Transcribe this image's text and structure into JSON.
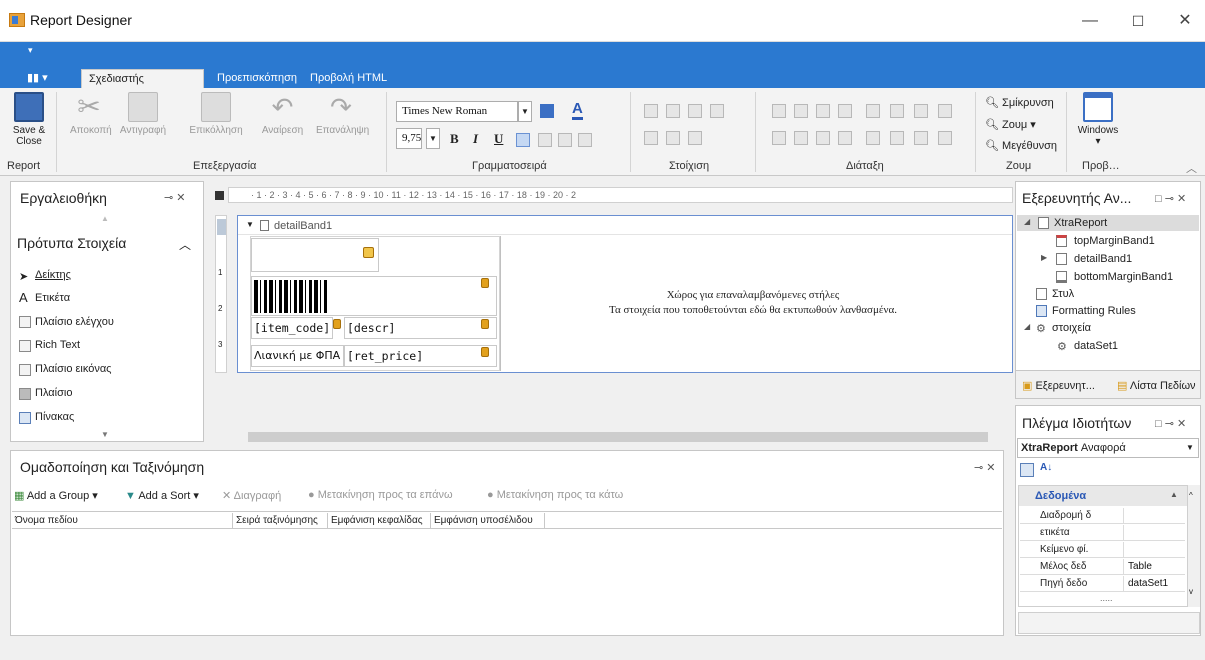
{
  "window": {
    "title": "Report Designer",
    "min": "—",
    "max": "☐",
    "close": "✕"
  },
  "tabs": [
    "Σχεδιαστής Αναφορών",
    "Προεπισκόπηση",
    "Προβολή HTML"
  ],
  "ribbon": {
    "save": "Save &",
    "save2": "Close",
    "cut": "Αποκοπή",
    "copy": "Αντιγραφή",
    "paste": "Επικόλληση",
    "undo": "Αναίρεση",
    "redo": "Επανάληψη",
    "font": "Times New Roman",
    "size": "9,75",
    "bold": "B",
    "italic": "I",
    "underline": "U",
    "zoomout": "Σμίκρυνση",
    "zoom": "Ζουμ",
    "zoomin": "Μεγέθυνση",
    "windows": "Windows",
    "groups": [
      "Report",
      "Επεξεργασία",
      "Γραμματοσειρά",
      "Στοίχιση",
      "Διάταξη",
      "Ζουμ",
      "Προβ…"
    ]
  },
  "toolbox": {
    "title": "Εργαλειοθήκη",
    "section": "Πρότυπα Στοιχεία",
    "items": [
      "Δείκτης",
      "Ετικέτα",
      "Πλαίσιο ελέγχου",
      "Rich Text",
      "Πλαίσιο εικόνας",
      "Πλαίσιο",
      "Πίνακας"
    ]
  },
  "ruler": "· 1 · 2 · 3 · 4 · 5 · 6 · 7 · 8 · 9 · 10 · 11 · 12 · 13 · 14 · 15 · 16 · 17 · 18 · 19 · 20 · 2",
  "band": {
    "name": "detailBand1",
    "msg1": "Χώρος για επαναλαμβανόμενες στήλες",
    "msg2": "Τα στοιχεία που τοποθετούνται εδώ θα εκτυπωθούν λανθασμένα.",
    "cells": [
      "[item_code]",
      "[descr]",
      "Λιανική με ΦΠΑ",
      "[ret_price]"
    ],
    "rulerNums": [
      "1",
      "2",
      "3"
    ]
  },
  "grouping": {
    "title": "Ομαδοποίηση και Ταξινόμηση",
    "addGroup": "Add a Group",
    "addSort": "Add a Sort",
    "delete": "Διαγραφή",
    "moveUp": "Μετακίνηση προς τα επάνω",
    "moveDown": "Μετακίνηση προς τα κάτω",
    "cols": [
      "Όνομα πεδίου",
      "Σειρά ταξινόμησης",
      "Εμφάνιση κεφαλίδας",
      "Εμφάνιση υποσέλιδου"
    ]
  },
  "explorer": {
    "title": "Εξερευνητής Αν...",
    "items": [
      "XtraReport",
      "topMarginBand1",
      "detailBand1",
      "bottomMarginBand1",
      "Στυλ",
      "Formatting Rules",
      "στοιχεία",
      "dataSet1"
    ],
    "tab1": "Εξερευνητ...",
    "tab2": "Λίστα Πεδίων"
  },
  "props": {
    "title": "Πλέγμα Ιδιοτήτων",
    "object": "XtraReport",
    "type": "Αναφορά",
    "category": "Δεδομένα",
    "rows": [
      {
        "k": "Διαδρομή δ",
        "v": ""
      },
      {
        "k": "ετικέτα",
        "v": ""
      },
      {
        "k": "Κείμενο φί.",
        "v": ""
      },
      {
        "k": "Μέλος δεδ",
        "v": "Table"
      },
      {
        "k": "Πηγή δεδο",
        "v": "dataSet1"
      }
    ],
    "more": "....."
  }
}
